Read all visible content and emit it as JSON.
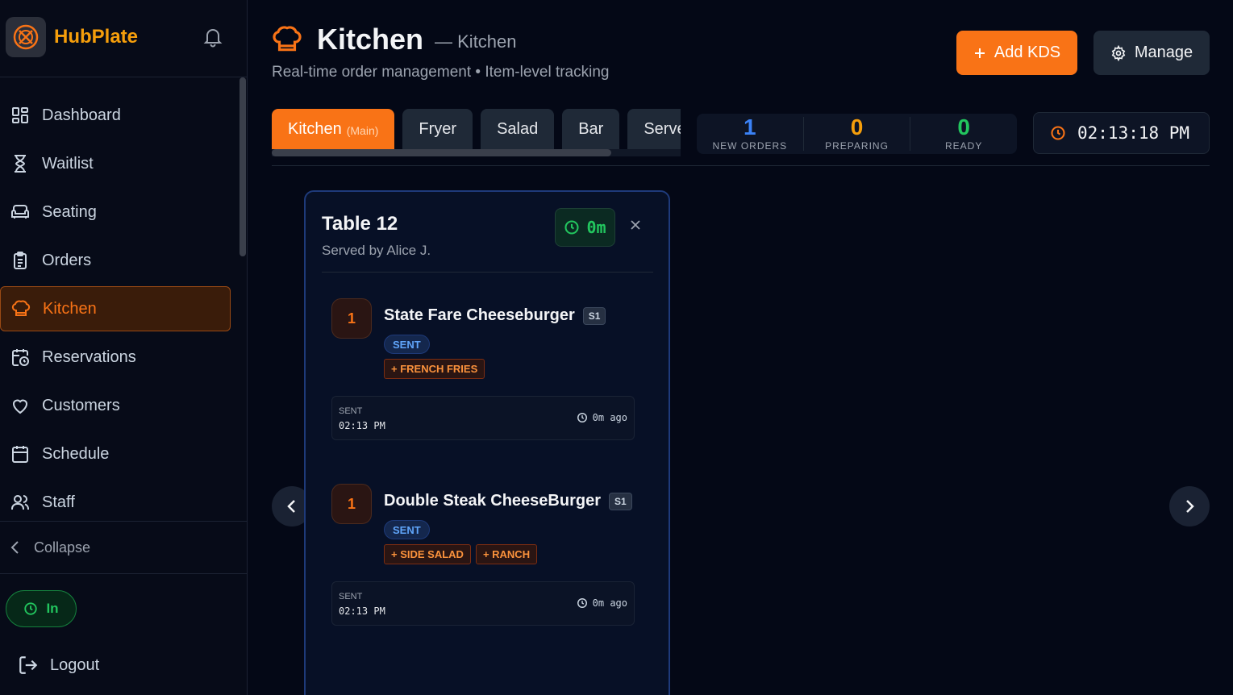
{
  "app": {
    "name": "HubPlate"
  },
  "sidebar": {
    "items": [
      {
        "label": "Dashboard",
        "icon": "dashboard-icon"
      },
      {
        "label": "Waitlist",
        "icon": "hourglass-icon"
      },
      {
        "label": "Seating",
        "icon": "sofa-icon"
      },
      {
        "label": "Orders",
        "icon": "clipboard-icon"
      },
      {
        "label": "Kitchen",
        "icon": "chef-hat-icon",
        "active": true
      },
      {
        "label": "Reservations",
        "icon": "calendar-clock-icon"
      },
      {
        "label": "Customers",
        "icon": "heart-icon"
      },
      {
        "label": "Schedule",
        "icon": "calendar-icon"
      },
      {
        "label": "Staff",
        "icon": "users-icon"
      }
    ],
    "collapse_label": "Collapse",
    "clock_status": "In",
    "logout_label": "Logout"
  },
  "header": {
    "title": "Kitchen",
    "title_sub": "— Kitchen",
    "subtitle": "Real-time order management • Item-level tracking",
    "add_button": "Add KDS",
    "manage_button": "Manage"
  },
  "stations": {
    "tabs": [
      {
        "label": "Kitchen",
        "tag": "(Main)",
        "active": true
      },
      {
        "label": "Fryer"
      },
      {
        "label": "Salad"
      },
      {
        "label": "Bar"
      },
      {
        "label": "Server"
      }
    ],
    "scroll_fraction_visible": 0.83
  },
  "stats": {
    "new_orders": {
      "value": "1",
      "label": "NEW ORDERS",
      "color": "#3b82f6"
    },
    "preparing": {
      "value": "0",
      "label": "PREPARING",
      "color": "#f59e0b"
    },
    "ready": {
      "value": "0",
      "label": "READY",
      "color": "#22c55e"
    }
  },
  "clock": {
    "time": "02:13:18 PM"
  },
  "ticket": {
    "table": "Table 12",
    "server": "Served by Alice J.",
    "timer": "0m",
    "items": [
      {
        "qty": "1",
        "name": "State Fare Cheeseburger",
        "seat": "S1",
        "status": "SENT",
        "modifiers": [
          "+ FRENCH FRIES"
        ],
        "sent_label": "SENT",
        "sent_time": "02:13 PM",
        "ago": "0m ago"
      },
      {
        "qty": "1",
        "name": "Double Steak CheeseBurger",
        "seat": "S1",
        "status": "SENT",
        "modifiers": [
          "+ SIDE SALAD",
          "+ RANCH"
        ],
        "sent_label": "SENT",
        "sent_time": "02:13 PM",
        "ago": "0m ago"
      }
    ]
  },
  "colors": {
    "accent": "#f97316",
    "brand": "#f59e0b",
    "background": "#040816"
  }
}
